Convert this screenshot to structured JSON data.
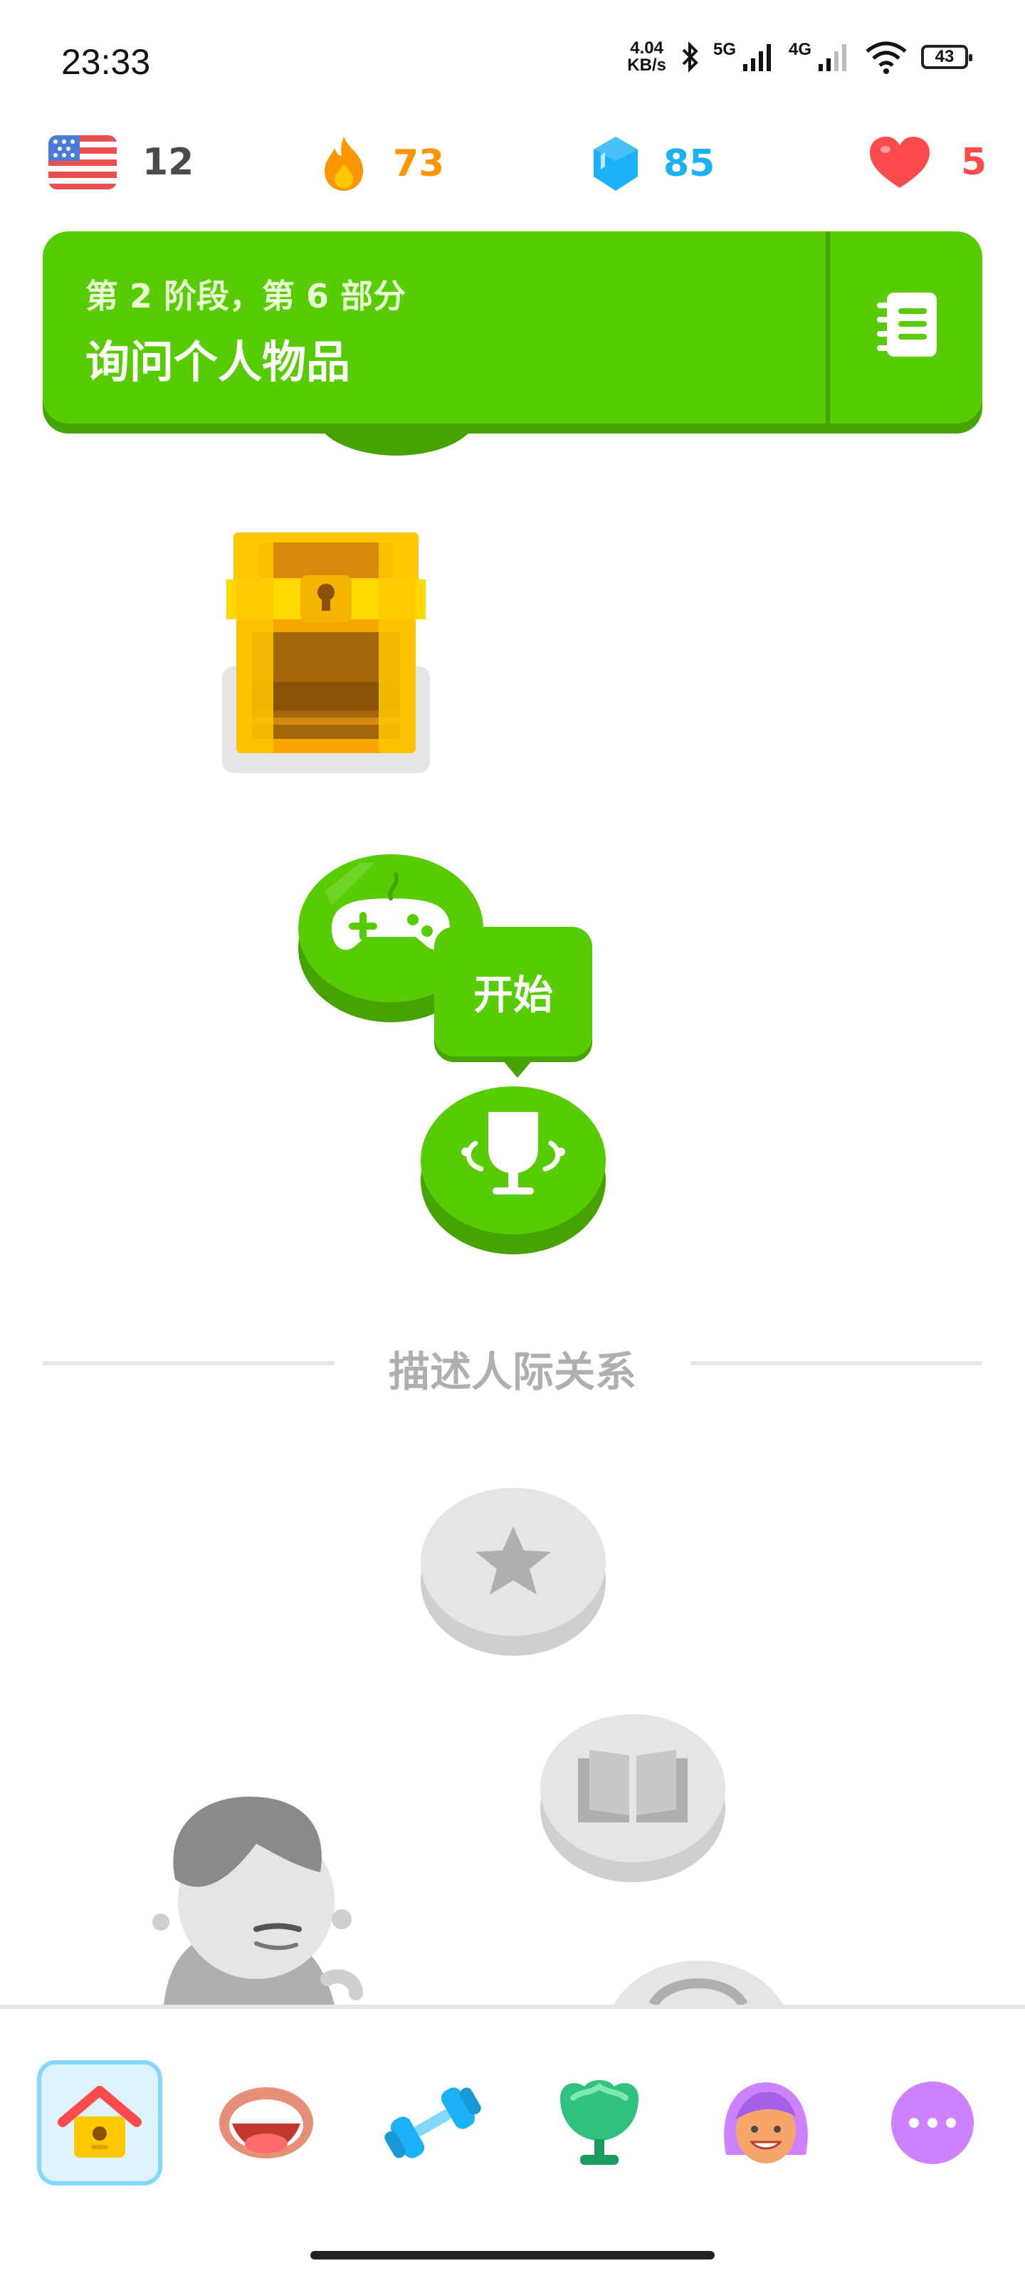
{
  "status_bar": {
    "time": "23:33",
    "net_speed_value": "4.04",
    "net_speed_unit": "KB/s",
    "signal_1": "5G",
    "signal_2": "4G",
    "battery": "43"
  },
  "stats": {
    "language_count": "12",
    "streak": "73",
    "gems": "85",
    "hearts": "5"
  },
  "unit_banner": {
    "subtitle": "第 2 阶段，第 6 部分",
    "title": "询问个人物品"
  },
  "path": {
    "start_tooltip": "开始",
    "next_section_title": "描述人际关系"
  },
  "colors": {
    "primary_green": "#58cc02",
    "dark_green": "#46a302",
    "streak_orange": "#ff9600",
    "gem_blue": "#1cb0f6",
    "heart_red": "#ff4b4b",
    "locked_gray": "#e5e5e5"
  },
  "icons": {
    "language": "us-flag-icon",
    "streak": "flame-icon",
    "gems": "gem-icon",
    "hearts": "heart-icon",
    "guide": "notebook-icon",
    "chest": "treasure-chest-icon",
    "game": "gamepad-icon",
    "trophy": "trophy-icon",
    "star": "star-icon",
    "book": "book-icon",
    "nav": [
      "home-icon",
      "mouth-icon",
      "dumbbell-icon",
      "leaderboard-cup-icon",
      "profile-avatar-icon",
      "more-icon"
    ]
  }
}
